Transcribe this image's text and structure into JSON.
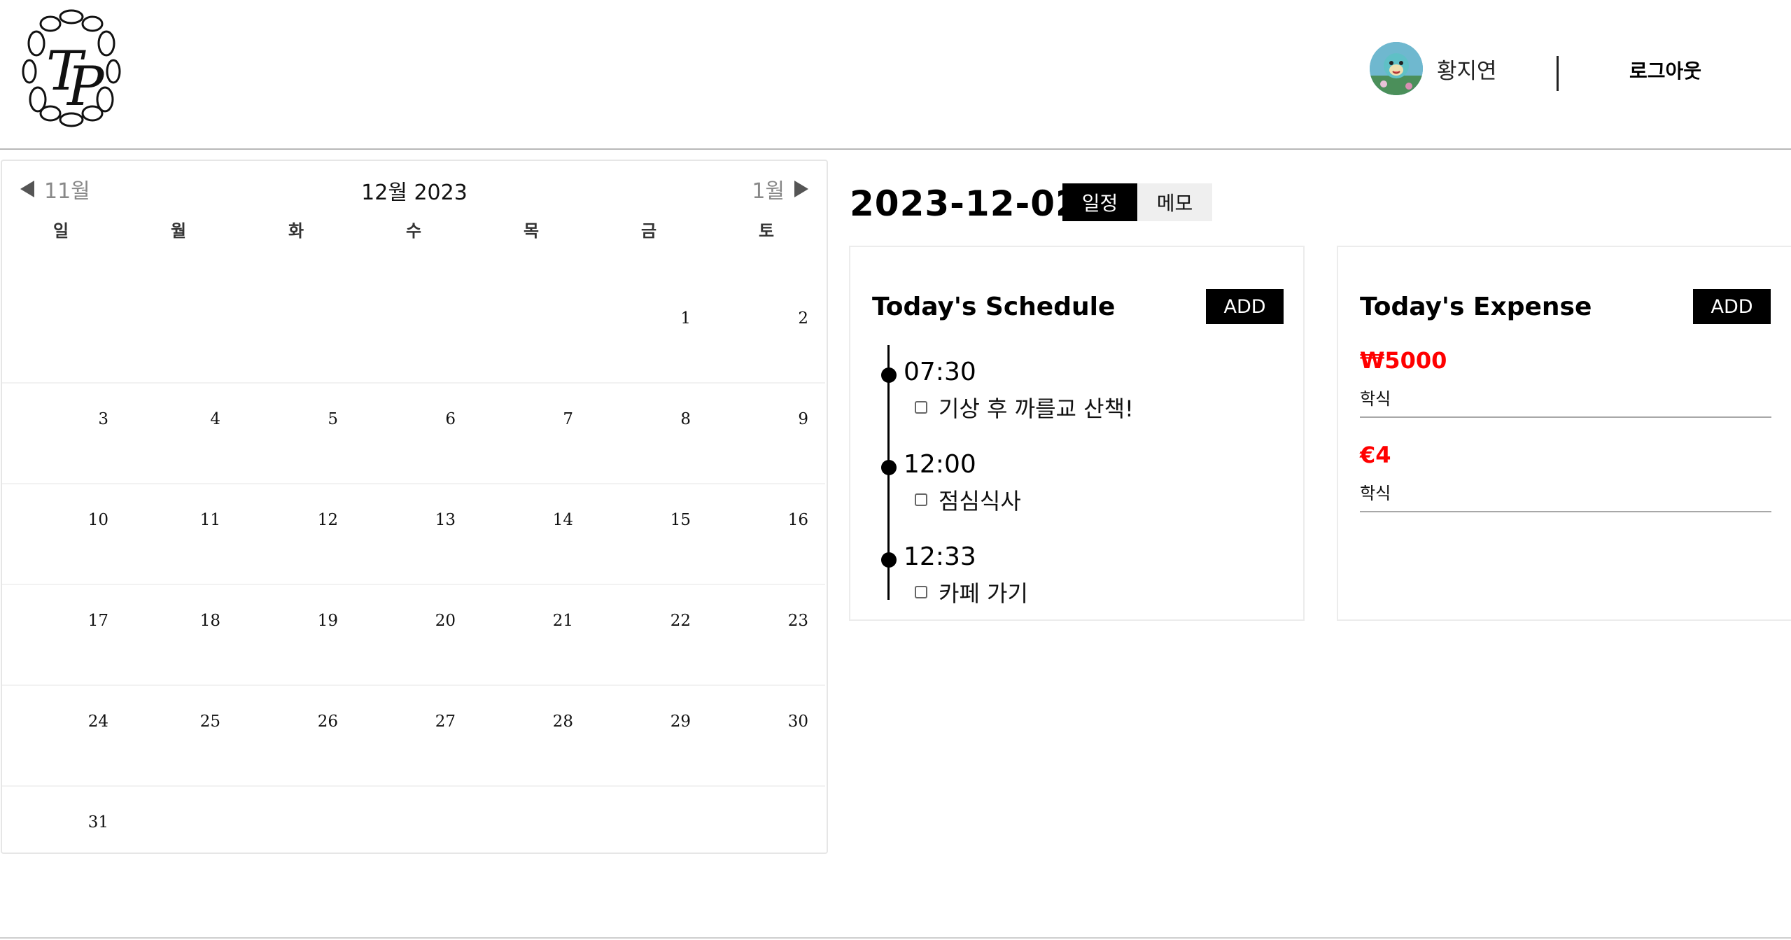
{
  "header": {
    "logo_alt": "TP",
    "user_name": "황지연",
    "logout_label": "로그아웃"
  },
  "calendar": {
    "prev_label": "11월",
    "title": "12월 2023",
    "next_label": "1월",
    "weekdays": [
      "일",
      "월",
      "화",
      "수",
      "목",
      "금",
      "토"
    ],
    "days": [
      "",
      "",
      "",
      "",
      "",
      "1",
      "2",
      "3",
      "4",
      "5",
      "6",
      "7",
      "8",
      "9",
      "10",
      "11",
      "12",
      "13",
      "14",
      "15",
      "16",
      "17",
      "18",
      "19",
      "20",
      "21",
      "22",
      "23",
      "24",
      "25",
      "26",
      "27",
      "28",
      "29",
      "30",
      "31",
      "",
      "",
      "",
      "",
      "",
      ""
    ]
  },
  "selected_date": "2023-12-02",
  "tabs": {
    "schedule": "일정",
    "memo": "메모"
  },
  "schedule": {
    "title": "Today's Schedule",
    "add_label": "ADD",
    "items": [
      {
        "time": "07:30",
        "text": "기상 후 까를교 산책!"
      },
      {
        "time": "12:00",
        "text": "점심식사"
      },
      {
        "time": "12:33",
        "text": "카페 가기"
      }
    ]
  },
  "expense": {
    "title": "Today's Expense",
    "add_label": "ADD",
    "items": [
      {
        "amount": "₩5000",
        "label": "학식"
      },
      {
        "amount": "€4",
        "label": "학식"
      }
    ]
  },
  "colors": {
    "accent": "#000000",
    "expense_amount": "#ff0000",
    "tab_inactive": "#efefef"
  }
}
